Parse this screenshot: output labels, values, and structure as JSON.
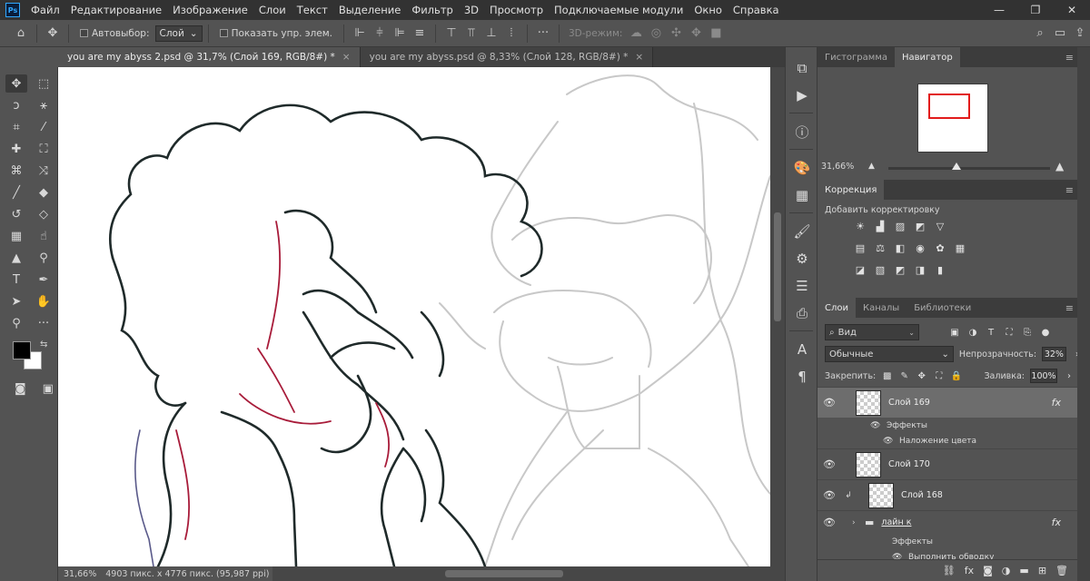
{
  "app": {
    "logo": "Ps"
  },
  "menu": [
    "Файл",
    "Редактирование",
    "Изображение",
    "Слои",
    "Текст",
    "Выделение",
    "Фильтр",
    "3D",
    "Просмотр",
    "Подключаемые модули",
    "Окно",
    "Справка"
  ],
  "window_controls": [
    "—",
    "❐",
    "✕"
  ],
  "options": {
    "autoselect_label": "Автовыбор:",
    "autoselect_value": "Слой",
    "show_transform_label": "Показать упр. элем.",
    "mode3d_label": "3D-режим:"
  },
  "tabs": [
    {
      "label": "you are my abyss 2.psd @ 31,7% (Слой 169, RGB/8#) *",
      "close": "×"
    },
    {
      "label": "you are my abyss.psd @ 8,33% (Слой 128, RGB/8#) *",
      "close": "×"
    }
  ],
  "status": {
    "zoom": "31,66%",
    "dimensions": "4903 пикс. x 4776 пикс. (95,987 ppi)",
    "arrow": "›"
  },
  "navigator": {
    "tab_hist": "Гистограмма",
    "tab_nav": "Навигатор",
    "zoom": "31,66%"
  },
  "adjustments": {
    "tab": "Коррекция",
    "title": "Добавить корректировку"
  },
  "layers_panel": {
    "tabs": [
      "Слои",
      "Каналы",
      "Библиотеки"
    ],
    "filter_label": "Вид",
    "blend_mode": "Обычные",
    "opacity_label": "Непрозрачность:",
    "opacity_value": "32%",
    "lock_label": "Закрепить:",
    "fill_label": "Заливка:",
    "fill_value": "100%",
    "fx_label": "fx",
    "layers": [
      {
        "name": "Слой 169",
        "selected": true
      },
      {
        "name": "Эффекты"
      },
      {
        "name": "Наложение цвета"
      },
      {
        "name": "Слой 170"
      },
      {
        "name": "Слой 168"
      },
      {
        "name": "лайн к"
      },
      {
        "name": "Эффекты"
      },
      {
        "name": "Выполнить обводку"
      }
    ]
  },
  "colors": {
    "foreground": "#000000",
    "background": "#ffffff",
    "nav_view_box": "#e21b1b"
  }
}
